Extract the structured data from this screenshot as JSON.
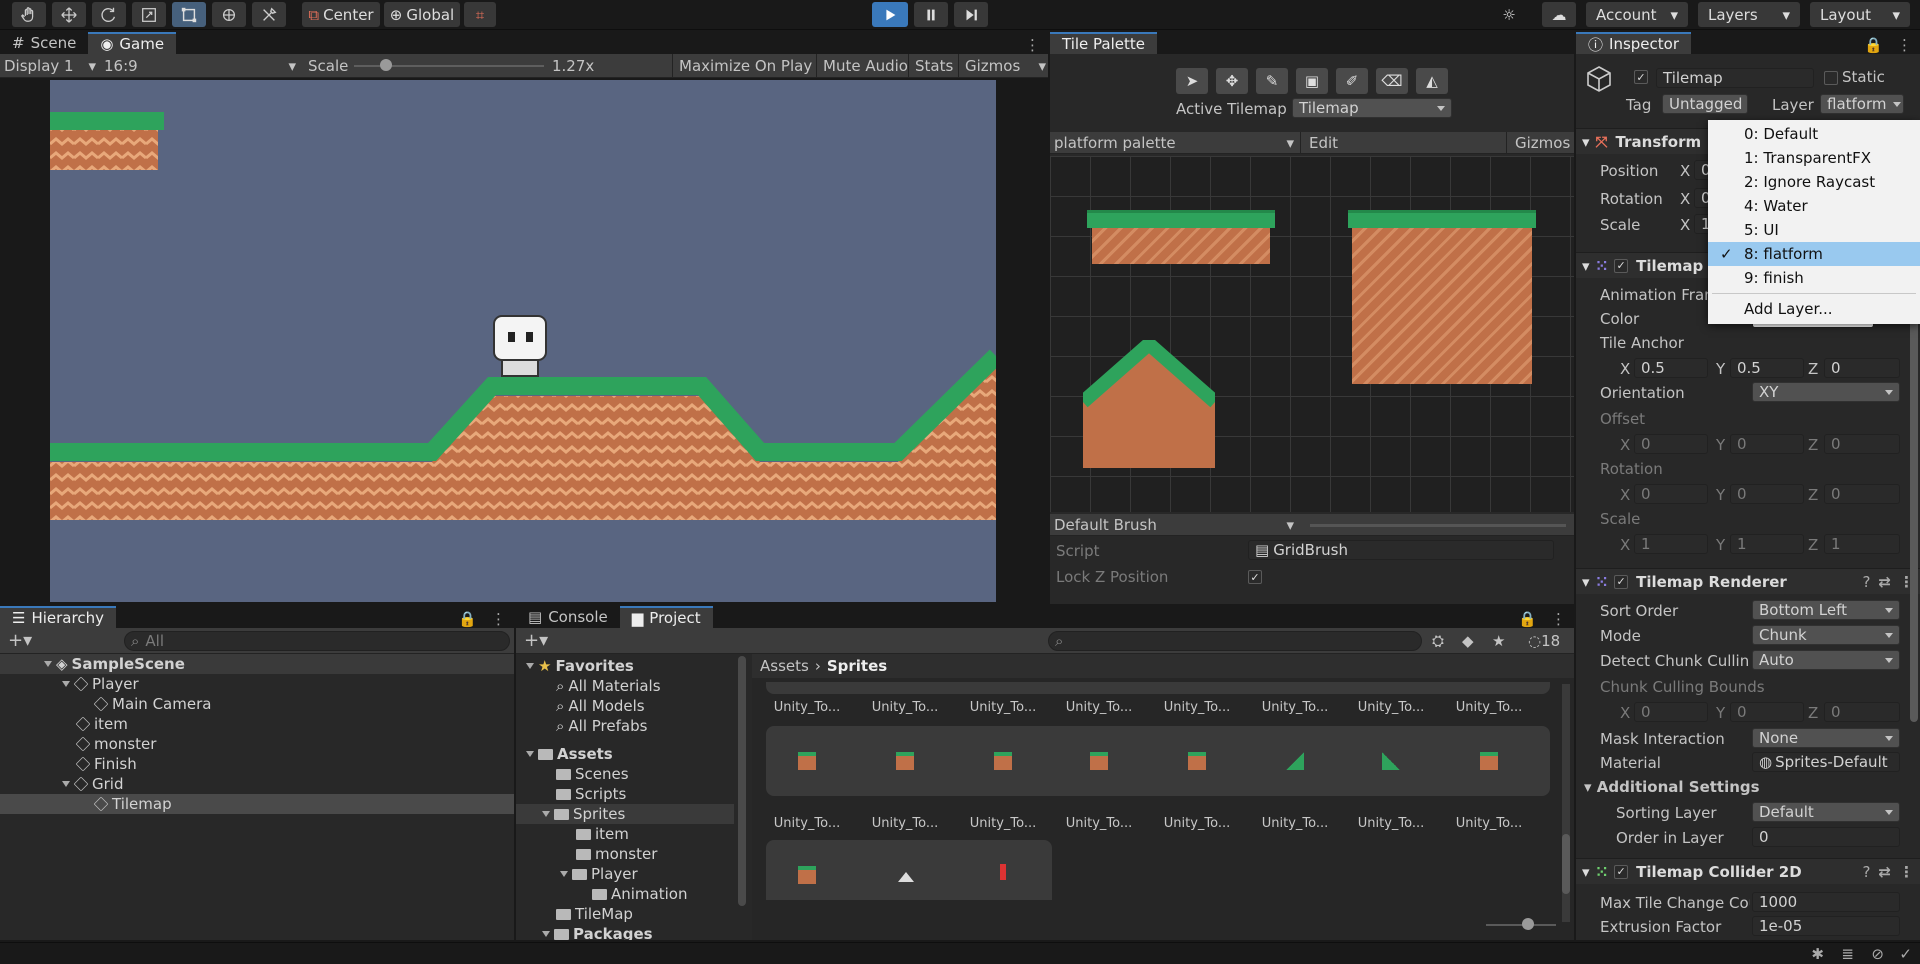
{
  "toolbar": {
    "center_label": "Center",
    "global_label": "Global",
    "account_label": "Account",
    "layers_label": "Layers",
    "layout_label": "Layout"
  },
  "scene_tabs": {
    "scene": "Scene",
    "game": "Game"
  },
  "game_bar": {
    "display": "Display 1",
    "aspect": "16:9",
    "scale_label": "Scale",
    "scale_value": "1.27x",
    "maximize": "Maximize On Play",
    "mute": "Mute Audio",
    "stats": "Stats",
    "gizmos": "Gizmos"
  },
  "tile_palette": {
    "tab": "Tile Palette",
    "active_tilemap_label": "Active Tilemap",
    "active_tilemap_value": "Tilemap",
    "palette": "platform palette",
    "edit": "Edit",
    "gizmos": "Gizmos",
    "brush": "Default Brush",
    "script_label": "Script",
    "script_value": "GridBrush",
    "lock_z": "Lock Z Position"
  },
  "inspector": {
    "tab": "Inspector",
    "object_name": "Tilemap",
    "static_label": "Static",
    "tag_label": "Tag",
    "tag_value": "Untagged",
    "layer_label": "Layer",
    "layer_value": "flatform",
    "transform": {
      "title": "Transform",
      "position": "Position",
      "rotation": "Rotation",
      "scale": "Scale",
      "x": "X",
      "pos_x": "0",
      "rot_x": "0",
      "scale_x": "1"
    },
    "tilemap": {
      "title": "Tilemap",
      "animation_frame": "Animation Frame",
      "color": "Color",
      "tile_anchor": "Tile Anchor",
      "anchor_x": "0.5",
      "anchor_y": "0.5",
      "anchor_z": "0",
      "orientation": "Orientation",
      "orientation_value": "XY",
      "offset": "Offset",
      "rotation": "Rotation",
      "scale": "Scale",
      "zero": "0",
      "one": "1",
      "x": "X",
      "y": "Y",
      "z": "Z"
    },
    "renderer": {
      "title": "Tilemap Renderer",
      "sort_order": "Sort Order",
      "sort_order_value": "Bottom Left",
      "mode": "Mode",
      "mode_value": "Chunk",
      "detect_culling": "Detect Chunk Culling",
      "detect_culling_value": "Auto",
      "culling_bounds": "Chunk Culling Bounds",
      "mask": "Mask Interaction",
      "mask_value": "None",
      "material": "Material",
      "material_value": "Sprites-Default",
      "additional": "Additional Settings",
      "sorting_layer": "Sorting Layer",
      "sorting_layer_value": "Default",
      "order": "Order in Layer",
      "order_value": "0"
    },
    "collider": {
      "title": "Tilemap Collider 2D",
      "max_tile": "Max Tile Change Count",
      "max_tile_value": "1000",
      "extrusion": "Extrusion Factor",
      "extrusion_value": "1e-05"
    }
  },
  "layer_menu": {
    "items": [
      "0: Default",
      "1: TransparentFX",
      "2: Ignore Raycast",
      "4: Water",
      "5: UI",
      "8: flatform",
      "9: finish"
    ],
    "add": "Add Layer..."
  },
  "hierarchy": {
    "tab": "Hierarchy",
    "search_placeholder": "All",
    "scene": "SampleScene",
    "items": [
      "Player",
      "Main Camera",
      "item",
      "monster",
      "Finish",
      "Grid",
      "Tilemap"
    ]
  },
  "project": {
    "console_tab": "Console",
    "project_tab": "Project",
    "hidden_count": "18",
    "favorites": "Favorites",
    "fav_items": [
      "All Materials",
      "All Models",
      "All Prefabs"
    ],
    "assets": "Assets",
    "folders": [
      "Scenes",
      "Scripts",
      "Sprites",
      "item",
      "monster",
      "Player",
      "Animation",
      "TileMap",
      "Packages"
    ],
    "breadcrumb_root": "Assets",
    "breadcrumb_current": "Sprites",
    "asset_label": "Unity_To..."
  },
  "colors": {
    "accent": "#3a79bb",
    "grass": "#2ea35c",
    "dirt": "#c07048",
    "sky": "#596581"
  }
}
